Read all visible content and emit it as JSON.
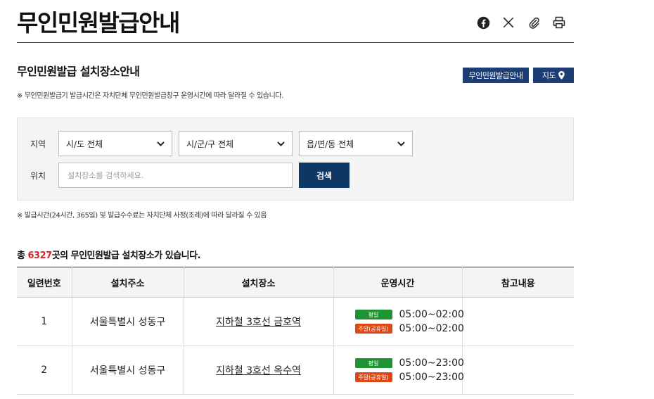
{
  "page": {
    "title": "무인민원발급안내",
    "subtitle": "무인민원발급 설치장소안내",
    "note": "※ 무인민원발급기 발급시간은 자치단체 무인민원발급창구 운영시간에 따라 달라질 수 있습니다."
  },
  "share_icons": [
    "facebook-icon",
    "x-icon",
    "link-icon",
    "print-icon"
  ],
  "buttons": {
    "info": "무인민원발급안내",
    "map": "지도"
  },
  "search": {
    "region_label": "지역",
    "location_label": "위치",
    "sido": "시/도 전체",
    "sigungu": "시/군/구 전체",
    "eupmyeondong": "읍/면/동 전체",
    "placeholder": "설치장소를 검색하세요.",
    "button": "검색"
  },
  "note2": "※ 발급시간(24시간, 365일) 및 발급수수료는 자치단체 사정(조례)에 따라 달라질 수 있음",
  "total": {
    "prefix": "총 ",
    "count": "6327",
    "suffix": "곳의 무인민원발급 설치장소가 있습니다."
  },
  "table": {
    "headers": [
      "일련번호",
      "설치주소",
      "설치장소",
      "운영시간",
      "참고내용"
    ],
    "rows": [
      {
        "no": "1",
        "address": "서울특별시 성동구",
        "place": "지하철 3호선 금호역",
        "weekday_label": "평일",
        "weekday_hours": "05:00~02:00",
        "holiday_label": "주말(공휴일)",
        "holiday_hours": "05:00~02:00",
        "ref": ""
      },
      {
        "no": "2",
        "address": "서울특별시 성동구",
        "place": "지하철 3호선 옥수역",
        "weekday_label": "평일",
        "weekday_hours": "05:00~23:00",
        "holiday_label": "주말(공휴일)",
        "holiday_hours": "05:00~23:00",
        "ref": ""
      }
    ]
  },
  "colors": {
    "accent": "#1d3d75",
    "search_button": "#0f3765",
    "count": "#d9232d",
    "weekday_badge": "#1f9433",
    "holiday_badge": "#de4814"
  }
}
